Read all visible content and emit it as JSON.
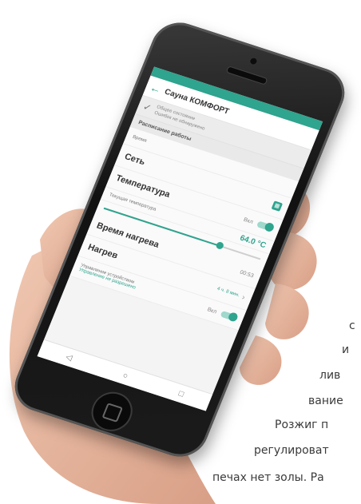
{
  "background_text": {
    "lines": [
      "с",
      "и",
      "лив",
      "вание",
      "Розжиг п",
      "регулироват",
      "печах нет золы. Ра"
    ]
  },
  "phone": {
    "status_bar": {
      "left": "",
      "right": ""
    },
    "app_bar": {
      "back_icon": "arrow-left-icon",
      "title": "Сауна КОМФОРТ"
    },
    "notice": {
      "line1": "Общее состояние",
      "line2": "Ошибок не обнаружено"
    },
    "section_mode": "Расписание работы",
    "rows": {
      "period_label": "Время",
      "network_label": "Сеть",
      "temperature_label": "Температура",
      "temperature_toggle_label": "Вкл",
      "current_temp_label": "Текущая температура",
      "current_temp_value": "64.0 °C",
      "heating_time_label": "Время нагрева",
      "heating_time_value": "00:53",
      "heat_label": "Нагрев",
      "heat_value": "4 ч. 8 мин.",
      "device_label": "Управление устройством",
      "device_link": "Управление не разрешено",
      "device_toggle_label": "Вкл"
    },
    "slider": {
      "fill_percent": 74
    },
    "nav": {
      "back": "◁",
      "home": "○",
      "recent": "□"
    }
  },
  "colors": {
    "accent": "#2fa48e",
    "phone_body": "#1b1b1b",
    "skin": "#e7b9a2"
  }
}
